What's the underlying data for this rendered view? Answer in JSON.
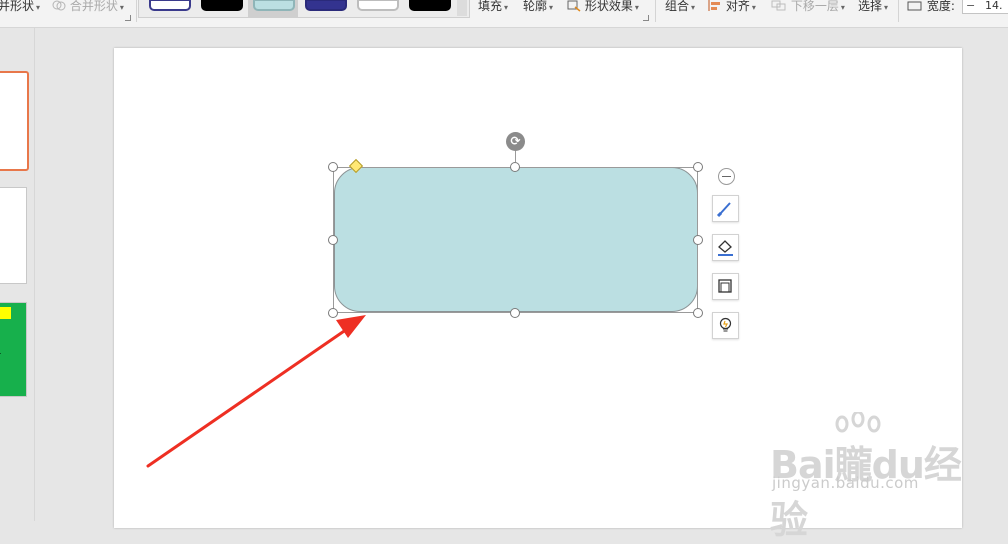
{
  "ribbon": {
    "merge_label_left": "并形状",
    "merge_shapes_label": "合并形状",
    "fill_label": "填充",
    "outline_label": "轮廓",
    "shape_effects_label": "形状效果",
    "group_label": "组合",
    "align_label": "对齐",
    "send_backward_label": "下移一层",
    "select_label": "选择",
    "width_label": "宽度:",
    "width_value": "14.",
    "style_swatches": [
      {
        "name": "outline-navy",
        "fill": "#ffffff",
        "border": "#3a3a8c"
      },
      {
        "name": "black",
        "fill": "#000000",
        "border": "#000000"
      },
      {
        "name": "light-teal",
        "fill": "#bbdfe2",
        "border": "#8fb5b8"
      },
      {
        "name": "navy",
        "fill": "#33338f",
        "border": "#2a2a7a"
      },
      {
        "name": "white",
        "fill": "#ffffff",
        "border": "#bdbdbd"
      },
      {
        "name": "black-2",
        "fill": "#000000",
        "border": "#000000"
      }
    ]
  },
  "watermark": {
    "logo_text": "Bai贚du经验",
    "url": "jingyan.baidu.com"
  },
  "colors": {
    "shape_fill": "#bbdfe2",
    "annotation_arrow": "#ee2f23",
    "active_thumb_border": "#e8774a",
    "thumb_green": "#17b04c",
    "thumb_yellow": "#ffff00"
  },
  "icons": [
    "merge-shapes-icon",
    "shape-effects-icon",
    "align-icon",
    "send-backward-icon",
    "width-icon",
    "rotate-icon",
    "collapse-icon",
    "style-brush-icon",
    "fill-bucket-icon",
    "outline-frame-icon",
    "smart-lightbulb-icon"
  ]
}
